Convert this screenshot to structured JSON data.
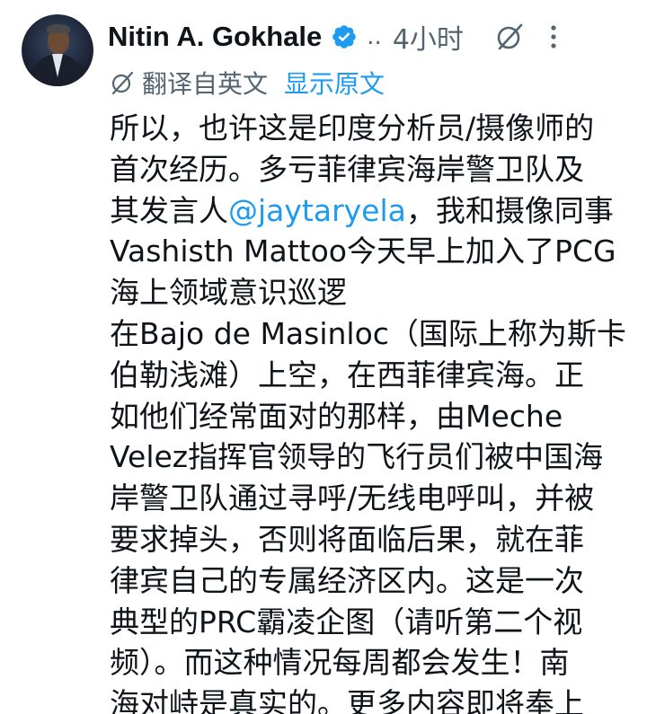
{
  "author": {
    "name": "Nitin A. Gokhale",
    "verified": true,
    "ellipsis": "..",
    "timestamp": "4小时"
  },
  "icons": {
    "avatar": "profile-photo",
    "verified": "verified-badge-icon",
    "grok": "grok-icon",
    "more": "more-vertical-icon",
    "translate": "translate-icon"
  },
  "translation": {
    "label": "翻译自英文",
    "show_original": "显示原文"
  },
  "body": {
    "line1": "所以，也许这是印度分析员/摄像师的",
    "line2": "首次经历。多亏菲律宾海岸警卫队及",
    "line3_pre": "其发言人",
    "line3_mention": "@jaytaryela",
    "line3_post": "，我和摄像同事",
    "line4": "Vashisth Mattoo今天早上加入了PCG",
    "line5": "海上领域意识巡逻",
    "line6": "在Bajo de Masinloc（国际上称为斯卡",
    "line7": "伯勒浅滩）上空，在西菲律宾海。正",
    "line8": "如他们经常面对的那样，由Meche",
    "line9": "Velez指挥官领导的飞行员们被中国海",
    "line10": "岸警卫队通过寻呼/无线电呼叫，并被",
    "line11": "要求掉头，否则将面临后果，就在菲",
    "line12": "律宾自己的专属经济区内。这是一次",
    "line13": "典型的PRC霸凌企图（请听第二个视",
    "line14": "频）。而这种情况每周都会发生！南",
    "line15": "海对峙是真实的。更多内容即将奉上"
  },
  "colors": {
    "text": "#0f1419",
    "secondary": "#536471",
    "link": "#1d9bf0",
    "verified": "#1d9bf0"
  }
}
